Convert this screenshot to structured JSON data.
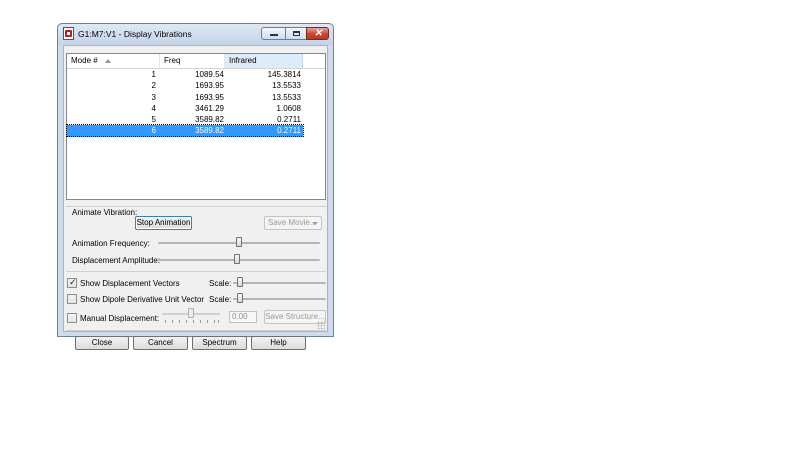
{
  "window": {
    "title": "G1:M7:V1 - Display Vibrations"
  },
  "table": {
    "headers": {
      "mode": "Mode #",
      "freq": "Freq",
      "infrared": "Infrared"
    },
    "rows": [
      {
        "mode": "1",
        "freq": "1089.54",
        "infrared": "145.3814"
      },
      {
        "mode": "2",
        "freq": "1693.95",
        "infrared": "13.5533"
      },
      {
        "mode": "3",
        "freq": "1693.95",
        "infrared": "13.5533"
      },
      {
        "mode": "4",
        "freq": "3461.29",
        "infrared": "1.0608"
      },
      {
        "mode": "5",
        "freq": "3589.82",
        "infrared": "0.2711"
      },
      {
        "mode": "6",
        "freq": "3589.82",
        "infrared": "0.2711"
      }
    ],
    "selected_mode": "6"
  },
  "animate": {
    "label": "Animate Vibration:",
    "stop_label": "Stop Animation",
    "save_movie_label": "Save Movie...",
    "frequency_label": "Animation Frequency:",
    "frequency_level": 0.5,
    "amplitude_label": "Displacement Amplitude:",
    "amplitude_level": 0.49
  },
  "vectors": {
    "displacement_label": "Show Displacement Vectors",
    "displacement_checked": true,
    "dipole_label": "Show Dipole Derivative Unit Vector",
    "dipole_checked": false,
    "scale_label": "Scale:",
    "scale1_level": 0.05,
    "scale2_level": 0.05
  },
  "manual": {
    "label": "Manual Displacement:",
    "checked": false,
    "value": "0.00",
    "save_structure_label": "Save Structure...",
    "level": 0.5
  },
  "buttons": {
    "close": "Close",
    "cancel": "Cancel",
    "spectrum": "Spectrum",
    "help": "Help"
  }
}
